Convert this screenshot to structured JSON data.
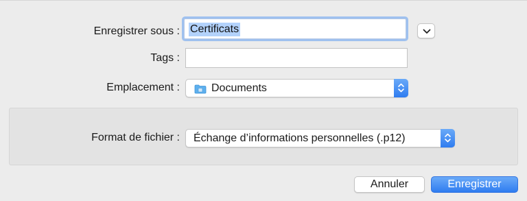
{
  "save_sheet": {
    "save_as_label": "Enregistrer sous :",
    "save_as_value": "Certificats",
    "tags_label": "Tags :",
    "tags_value": "",
    "location_label": "Emplacement :",
    "location_value": "Documents",
    "location_icon": "folder-icon",
    "expand_icon": "chevron-down-icon",
    "format_label": "Format de fichier :",
    "format_value": "Échange d’informations personnelles (.p12)",
    "cancel_label": "Annuler",
    "save_label": "Enregistrer"
  },
  "colors": {
    "background": "#ececec",
    "accent": "#2f7cf0",
    "selection": "#b3d2fb",
    "focus_ring": "#9fc1ef"
  }
}
